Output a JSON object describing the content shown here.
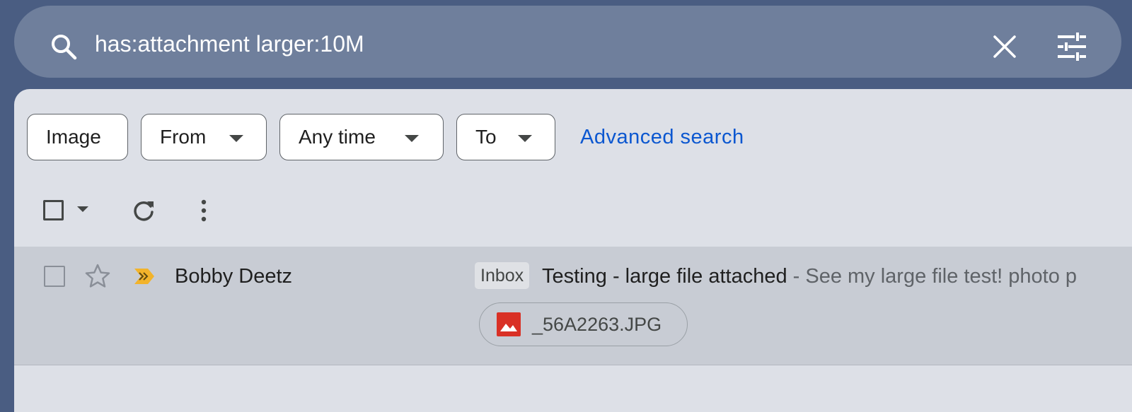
{
  "search": {
    "query": "has:attachment larger:10M"
  },
  "icons": {
    "search": "search-icon",
    "clear": "close-icon",
    "options": "tune-icon",
    "refresh": "refresh-icon",
    "more": "more-vert-icon",
    "star": "star-icon",
    "important": "important-marker-icon",
    "attachment": "image-file-icon"
  },
  "filters": {
    "image_label": "Image",
    "from_label": "From",
    "time_label": "Any time",
    "to_label": "To",
    "advanced_label": "Advanced search"
  },
  "emails": [
    {
      "sender": "Bobby Deetz",
      "label": "Inbox",
      "subject": "Testing - large file attached",
      "snippet": " - See my large file test! photo p",
      "attachment": "_56A2263.JPG"
    }
  ],
  "colors": {
    "background": "#4a5d82",
    "search_bar": "#6f7f9c",
    "panel": "#dde0e7",
    "link": "#0b57d0",
    "important": "#f2b32b",
    "image_icon": "#d93025"
  }
}
